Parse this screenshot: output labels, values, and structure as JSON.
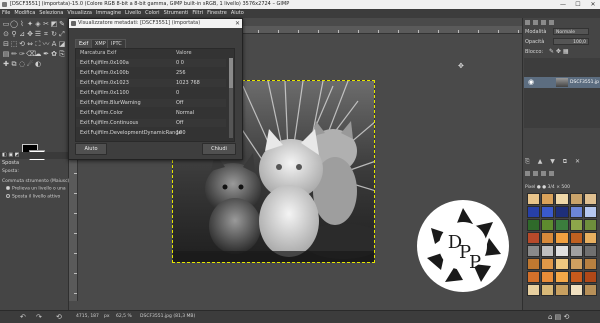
{
  "window": {
    "title": "[DSCF3551] (importata)-15.0 (Colore RGB 8-bit a 8-bit gamma, GIMP built-in sRGB, 1 livello) 3576x2724 – GIMP",
    "controls": [
      "—",
      "☐",
      "✕"
    ]
  },
  "menubar": [
    "File",
    "Modifica",
    "Seleziona",
    "Visualizza",
    "Immagine",
    "Livello",
    "Colori",
    "Strumenti",
    "Filtri",
    "Finestre",
    "Aiuto"
  ],
  "toolbox": {
    "tools_icons": [
      "rect-select-icon",
      "ellipse-select-icon",
      "free-select-icon",
      "fuzzy-select-icon",
      "color-select-icon",
      "scissors-icon",
      "foreground-select-icon",
      "paths-icon",
      "color-picker-icon",
      "zoom-icon",
      "measure-icon",
      "move-icon",
      "align-icon",
      "crop-icon",
      "rotate-icon",
      "scale-icon",
      "shear-icon",
      "perspective-icon",
      "transform-icon",
      "flip-icon",
      "cage-icon",
      "warp-icon",
      "text-icon",
      "bucket-icon",
      "gradient-icon",
      "pencil-icon",
      "paintbrush-icon",
      "eraser-icon",
      "airbrush-icon",
      "ink-icon",
      "mypaint-icon",
      "clone-icon",
      "heal-icon",
      "perspective-clone-icon",
      "blur-icon",
      "smudge-icon",
      "dodge-icon"
    ],
    "tool_panel_title": "Sposta",
    "tool_panel_subtitle": "Sposta:",
    "option_label": "Commuta strumento (Maiusc)",
    "options": [
      "Prelieva un livello o una",
      "Sposta il livello attivo"
    ]
  },
  "dialog": {
    "title": "Visualizzatore metadati: [DSCF3551] (importata)",
    "tabs": [
      "Exif",
      "XMP",
      "IPTC"
    ],
    "active_tab": "Exif",
    "columns": [
      "Marcatura Exif",
      "Valore"
    ],
    "rows": [
      {
        "key": "Exif.Fujifilm.0x100a",
        "value": "0 0"
      },
      {
        "key": "Exif.Fujifilm.0x100b",
        "value": "256"
      },
      {
        "key": "Exif.Fujifilm.0x1023",
        "value": "1023 768"
      },
      {
        "key": "Exif.Fujifilm.0x1100",
        "value": "0"
      },
      {
        "key": "Exif.Fujifilm.BlurWarning",
        "value": "Off"
      },
      {
        "key": "Exif.Fujifilm.Color",
        "value": "Normal"
      },
      {
        "key": "Exif.Fujifilm.Continuous",
        "value": "Off"
      },
      {
        "key": "Exif.Fujifilm.DevelopmentDynamicRange",
        "value": "100"
      }
    ],
    "help_button": "Aiuto",
    "close_button": "Chiudi"
  },
  "right_dock": {
    "mode_label": "Modalità",
    "mode_value": "Normale",
    "opacity_label": "Opacità",
    "opacity_value": "100,0",
    "lock_label": "Blocco:",
    "layer_name": "DSCF3551.jp",
    "brush_filter": "Pixel ● ● 3/4 × 500",
    "brush_colors": [
      "#e8c48a",
      "#d9a25a",
      "#f0d8a8",
      "#c9a36a",
      "#e0c090",
      "#2740a8",
      "#3a5acb",
      "#1e2f7a",
      "#6c86d8",
      "#b6c8f0",
      "#2f6a2a",
      "#5e8c2e",
      "#3b7d3d",
      "#8da64a",
      "#6e8e3c",
      "#b84a2a",
      "#d88a3a",
      "#f0a040",
      "#c06020",
      "#e8b060",
      "#8a8a8a",
      "#c0c0c0",
      "#e0e0e0",
      "#a0a0a0",
      "#707070",
      "#c07830",
      "#e09848",
      "#f0c880",
      "#d0a060",
      "#b88040",
      "#d4702a",
      "#e88c38",
      "#f4a848",
      "#c85a1c",
      "#b04818",
      "#e8d0a0",
      "#d8b878",
      "#c8a060",
      "#f0e0c0",
      "#b89058"
    ]
  },
  "statusbar": {
    "unit": "px",
    "zoom": "62,5 %",
    "file_info": "DSCF3551.jpg (81,3 MB)",
    "coords": "4715, 187"
  },
  "logo": {
    "letters": "DPP"
  },
  "colors": {
    "accent": "#5c6d80",
    "selection": "#e6e600",
    "panel": "#454545",
    "dark": "#3c3c3c"
  }
}
